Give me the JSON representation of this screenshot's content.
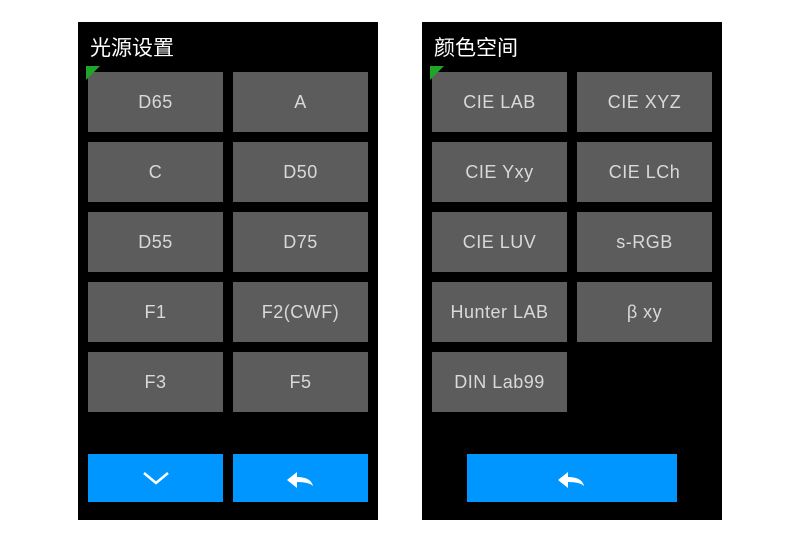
{
  "panels": {
    "light": {
      "title": "光源设置",
      "options": [
        "D65",
        "A",
        "C",
        "D50",
        "D55",
        "D75",
        "F1",
        "F2(CWF)",
        "F3",
        "F5"
      ]
    },
    "color": {
      "title": "颜色空间",
      "options": [
        "CIE LAB",
        "CIE XYZ",
        "CIE Yxy",
        "CIE LCh",
        "CIE LUV",
        "s-RGB",
        "Hunter LAB",
        "β xy",
        "DIN Lab99"
      ]
    }
  },
  "colors": {
    "accent": "#0096ff",
    "button": "#5c5c5c",
    "indicator": "#1fa62a"
  }
}
